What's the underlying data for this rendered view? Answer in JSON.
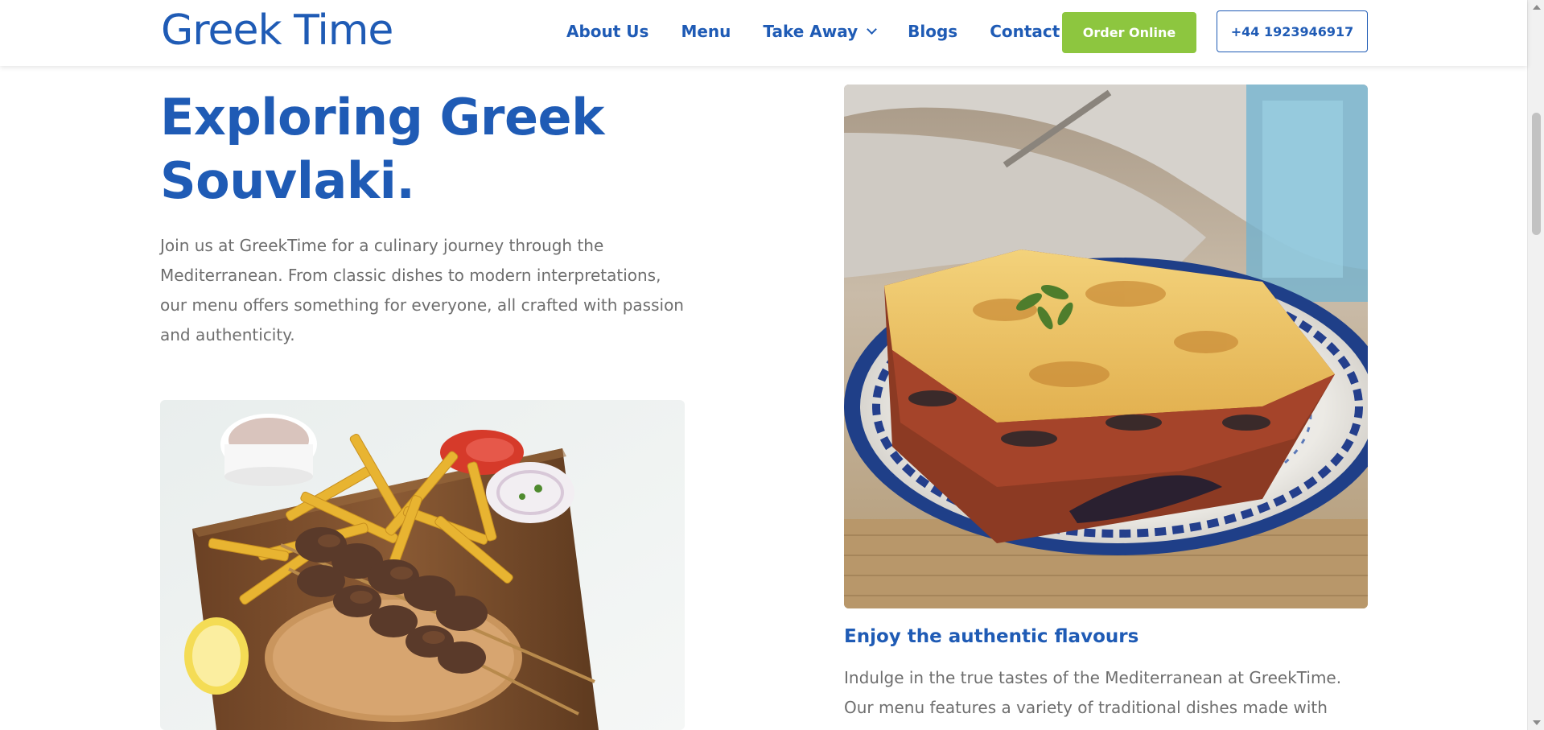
{
  "header": {
    "logo": "Greek Time",
    "nav": [
      {
        "label": "About Us"
      },
      {
        "label": "Menu"
      },
      {
        "label": "Take Away"
      },
      {
        "label": "Blogs"
      },
      {
        "label": "Contact"
      }
    ],
    "order_button": "Order Online",
    "phone_button": "+44 1923946917"
  },
  "hero": {
    "title_line1": "Exploring Greek",
    "title_line2": "Souvlaki.",
    "text": "Join us at GreekTime for a culinary journey through the Mediterranean. From classic dishes to modern interpretations, our menu offers something for everyone, all crafted with passion and authenticity."
  },
  "feature": {
    "title": "Enjoy the authentic flavours",
    "text": "Indulge in the true tastes of the Mediterranean at GreekTime. Our menu features a variety of traditional dishes made with fresh, high-"
  },
  "icons": {
    "take_away_dropdown": "chevron-down-icon"
  },
  "colors": {
    "brand_blue": "#1f5bb5",
    "order_green": "#8dc63f",
    "body_text": "#6e6e6e"
  }
}
